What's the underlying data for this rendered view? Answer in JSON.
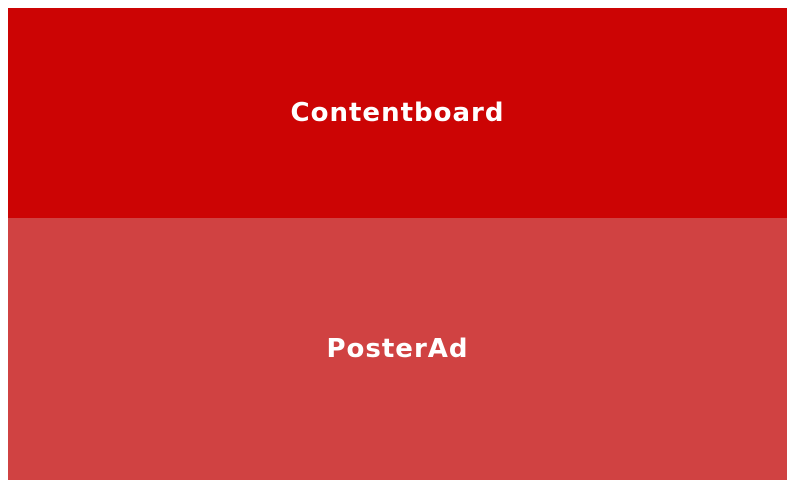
{
  "contentboard": {
    "label": "Contentboard",
    "background": "#cc0404"
  },
  "poster_ad": {
    "label": "PosterAd",
    "background": "#d04242"
  },
  "text_color": "#ffffff"
}
